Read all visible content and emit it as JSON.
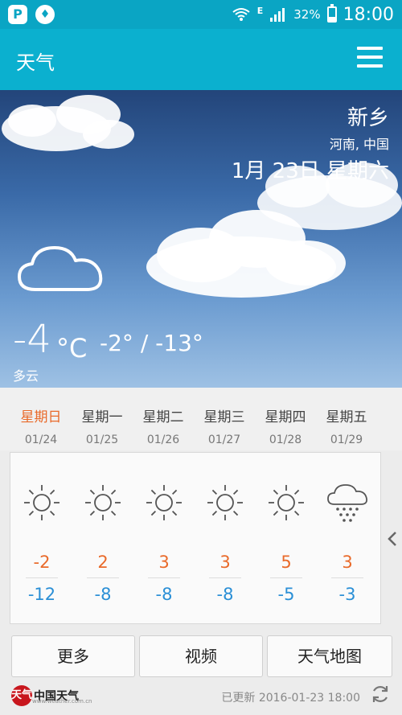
{
  "status_bar": {
    "app_icon_1": "P",
    "app_icon_2": "♦",
    "network": "E",
    "battery_percent": "32%",
    "battery_level": 0.32,
    "time": "18:00"
  },
  "appbar": {
    "title": "天气"
  },
  "current": {
    "city": "新乡",
    "region": "河南, 中国",
    "date": "1月 23日 星期六",
    "temp": "-4",
    "unit": "°C",
    "range": "-2° / -13°",
    "condition": "多云"
  },
  "forecast": [
    {
      "day": "星期日",
      "date": "01/24",
      "hi": "-2",
      "lo": "-12",
      "icon": "sun-icon",
      "today": true
    },
    {
      "day": "星期一",
      "date": "01/25",
      "hi": "2",
      "lo": "-8",
      "icon": "sun-icon"
    },
    {
      "day": "星期二",
      "date": "01/26",
      "hi": "3",
      "lo": "-8",
      "icon": "sun-icon"
    },
    {
      "day": "星期三",
      "date": "01/27",
      "hi": "3",
      "lo": "-8",
      "icon": "sun-icon"
    },
    {
      "day": "星期四",
      "date": "01/28",
      "hi": "5",
      "lo": "-5",
      "icon": "sun-icon"
    },
    {
      "day": "星期五",
      "date": "01/29",
      "hi": "3",
      "lo": "-3",
      "icon": "snow-icon"
    }
  ],
  "buttons": {
    "more": "更多",
    "video": "视频",
    "map": "天气地图"
  },
  "footer": {
    "brand_mark": "天气",
    "brand_name": "中国天气",
    "brand_url": "www.weather.com.cn",
    "updated": "已更新 2016-01-23 18:00"
  },
  "colors": {
    "accent": "#0bb0cf",
    "today": "#e96a2a",
    "high": "#e96a2a",
    "low": "#2a8fd6"
  }
}
